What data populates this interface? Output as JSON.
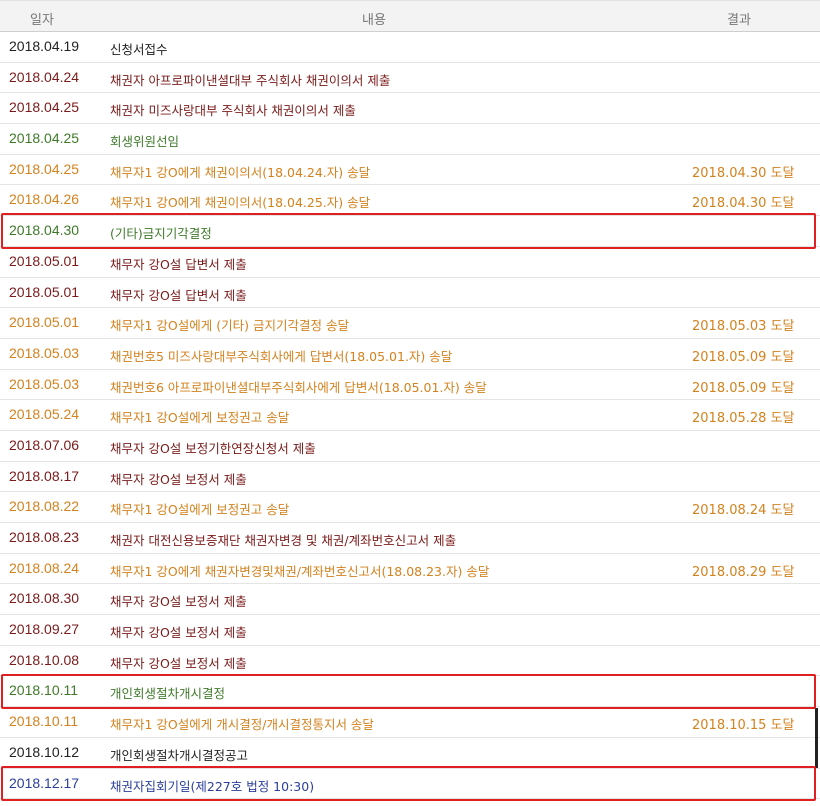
{
  "header": {
    "date": "일자",
    "content": "내용",
    "result": "결과"
  },
  "rows": [
    {
      "date": "2018.04.19",
      "content": "신청서접수",
      "result": "",
      "color": "black"
    },
    {
      "date": "2018.04.24",
      "content": "채권자 아프로파이낸셜대부 주식회사 채권이의서 제출",
      "result": "",
      "color": "maroon"
    },
    {
      "date": "2018.04.25",
      "content": "채권자 미즈사랑대부 주식회사 채권이의서 제출",
      "result": "",
      "color": "maroon"
    },
    {
      "date": "2018.04.25",
      "content": "회생위원선임",
      "result": "",
      "color": "green"
    },
    {
      "date": "2018.04.25",
      "content": "채무자1 강O에게 채권이의서(18.04.24.자) 송달",
      "result": "2018.04.30 도달",
      "color": "orange"
    },
    {
      "date": "2018.04.26",
      "content": "채무자1 강O에게 채권이의서(18.04.25.자) 송달",
      "result": "2018.04.30 도달",
      "color": "orange"
    },
    {
      "date": "2018.04.30",
      "content": "(기타)금지기각결정",
      "result": "",
      "color": "green",
      "highlight": true
    },
    {
      "date": "2018.05.01",
      "content": "채무자 강O설 답변서 제출",
      "result": "",
      "color": "maroon"
    },
    {
      "date": "2018.05.01",
      "content": "채무자 강O설 답변서 제출",
      "result": "",
      "color": "maroon"
    },
    {
      "date": "2018.05.01",
      "content": "채무자1 강O설에게 (기타) 금지기각결정 송달",
      "result": "2018.05.03 도달",
      "color": "orange"
    },
    {
      "date": "2018.05.03",
      "content": "채권번호5 미즈사랑대부주식회사에게 답변서(18.05.01.자) 송달",
      "result": "2018.05.09 도달",
      "color": "orange"
    },
    {
      "date": "2018.05.03",
      "content": "채권번호6 아프로파이낸셜대부주식회사에게 답변서(18.05.01.자) 송달",
      "result": "2018.05.09 도달",
      "color": "orange"
    },
    {
      "date": "2018.05.24",
      "content": "채무자1 강O설에게 보정권고 송달",
      "result": "2018.05.28 도달",
      "color": "orange"
    },
    {
      "date": "2018.07.06",
      "content": "채무자 강O설 보정기한연장신청서 제출",
      "result": "",
      "color": "maroon"
    },
    {
      "date": "2018.08.17",
      "content": "채무자 강O설 보정서 제출",
      "result": "",
      "color": "maroon"
    },
    {
      "date": "2018.08.22",
      "content": "채무자1 강O설에게 보정권고 송달",
      "result": "2018.08.24 도달",
      "color": "orange"
    },
    {
      "date": "2018.08.23",
      "content": "채권자 대전신용보증재단 채권자변경 및 채권/계좌번호신고서 제출",
      "result": "",
      "color": "maroon"
    },
    {
      "date": "2018.08.24",
      "content": "채무자1 강O에게 채권자변경및채권/계좌번호신고서(18.08.23.자) 송달",
      "result": "2018.08.29 도달",
      "color": "orange"
    },
    {
      "date": "2018.08.30",
      "content": "채무자 강O설 보정서 제출",
      "result": "",
      "color": "maroon"
    },
    {
      "date": "2018.09.27",
      "content": "채무자 강O설 보정서 제출",
      "result": "",
      "color": "maroon"
    },
    {
      "date": "2018.10.08",
      "content": "채무자 강O설 보정서 제출",
      "result": "",
      "color": "maroon"
    },
    {
      "date": "2018.10.11",
      "content": "개인회생절차개시결정",
      "result": "",
      "color": "green",
      "highlight": true
    },
    {
      "date": "2018.10.11",
      "content": "채무자1 강O설에게 개시결정/개시결정통지서 송달",
      "result": "2018.10.15 도달",
      "color": "orange"
    },
    {
      "date": "2018.10.12",
      "content": "개인회생절차개시결정공고",
      "result": "",
      "color": "black"
    },
    {
      "date": "2018.12.17",
      "content": "채권자집회기일(제227호 법정 10:30)",
      "result": "",
      "color": "blue",
      "highlight": true
    }
  ]
}
